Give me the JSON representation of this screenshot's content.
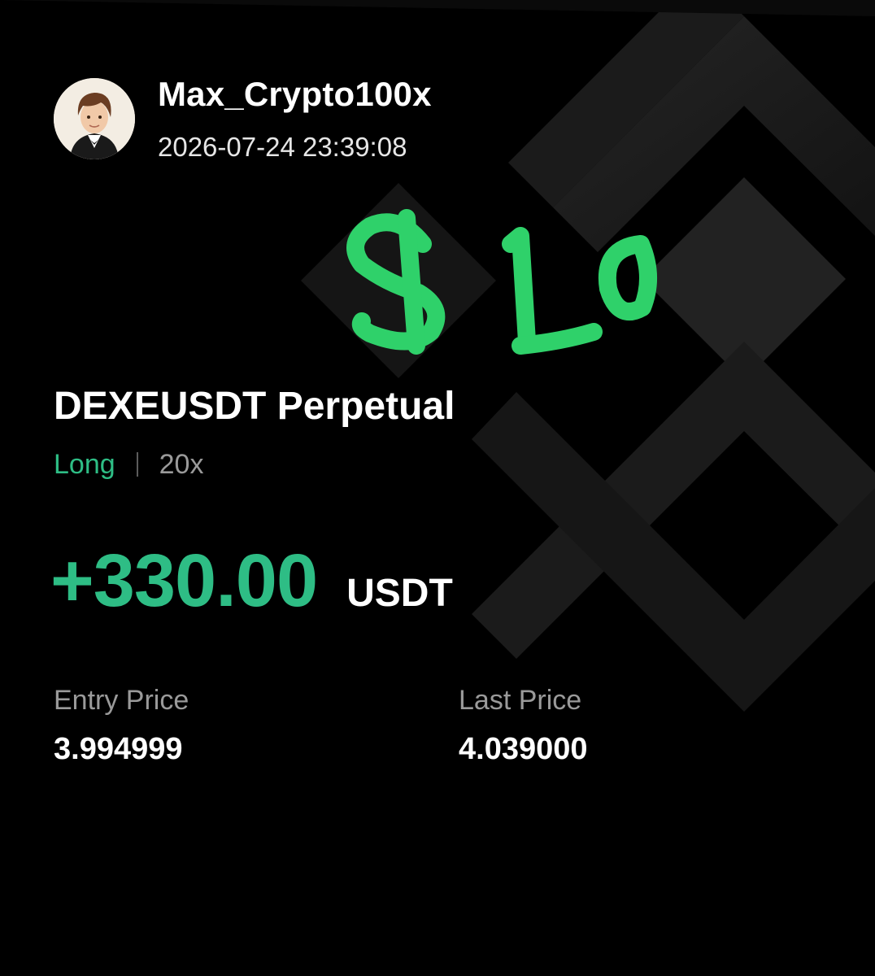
{
  "profile": {
    "username": "Max_Crypto100x",
    "timestamp": "2026-07-24 23:39:08",
    "avatar_icon": "avatar-illustration"
  },
  "annotation": {
    "handwritten_text": "$10",
    "color": "#2fd16a"
  },
  "position": {
    "symbol": "DEXEUSDT Perpetual",
    "side": "Long",
    "leverage": "20x",
    "pnl": "+330.00",
    "pnl_unit": "USDT"
  },
  "prices": {
    "entry_label": "Entry Price",
    "entry_value": "3.994999",
    "last_label": "Last Price",
    "last_value": "4.039000"
  },
  "colors": {
    "background": "#000000",
    "positive": "#2ebd85",
    "muted": "#9a9a9a",
    "logo": "#1c1c1c"
  },
  "icons": {
    "background": "binance-logo-watermark"
  }
}
